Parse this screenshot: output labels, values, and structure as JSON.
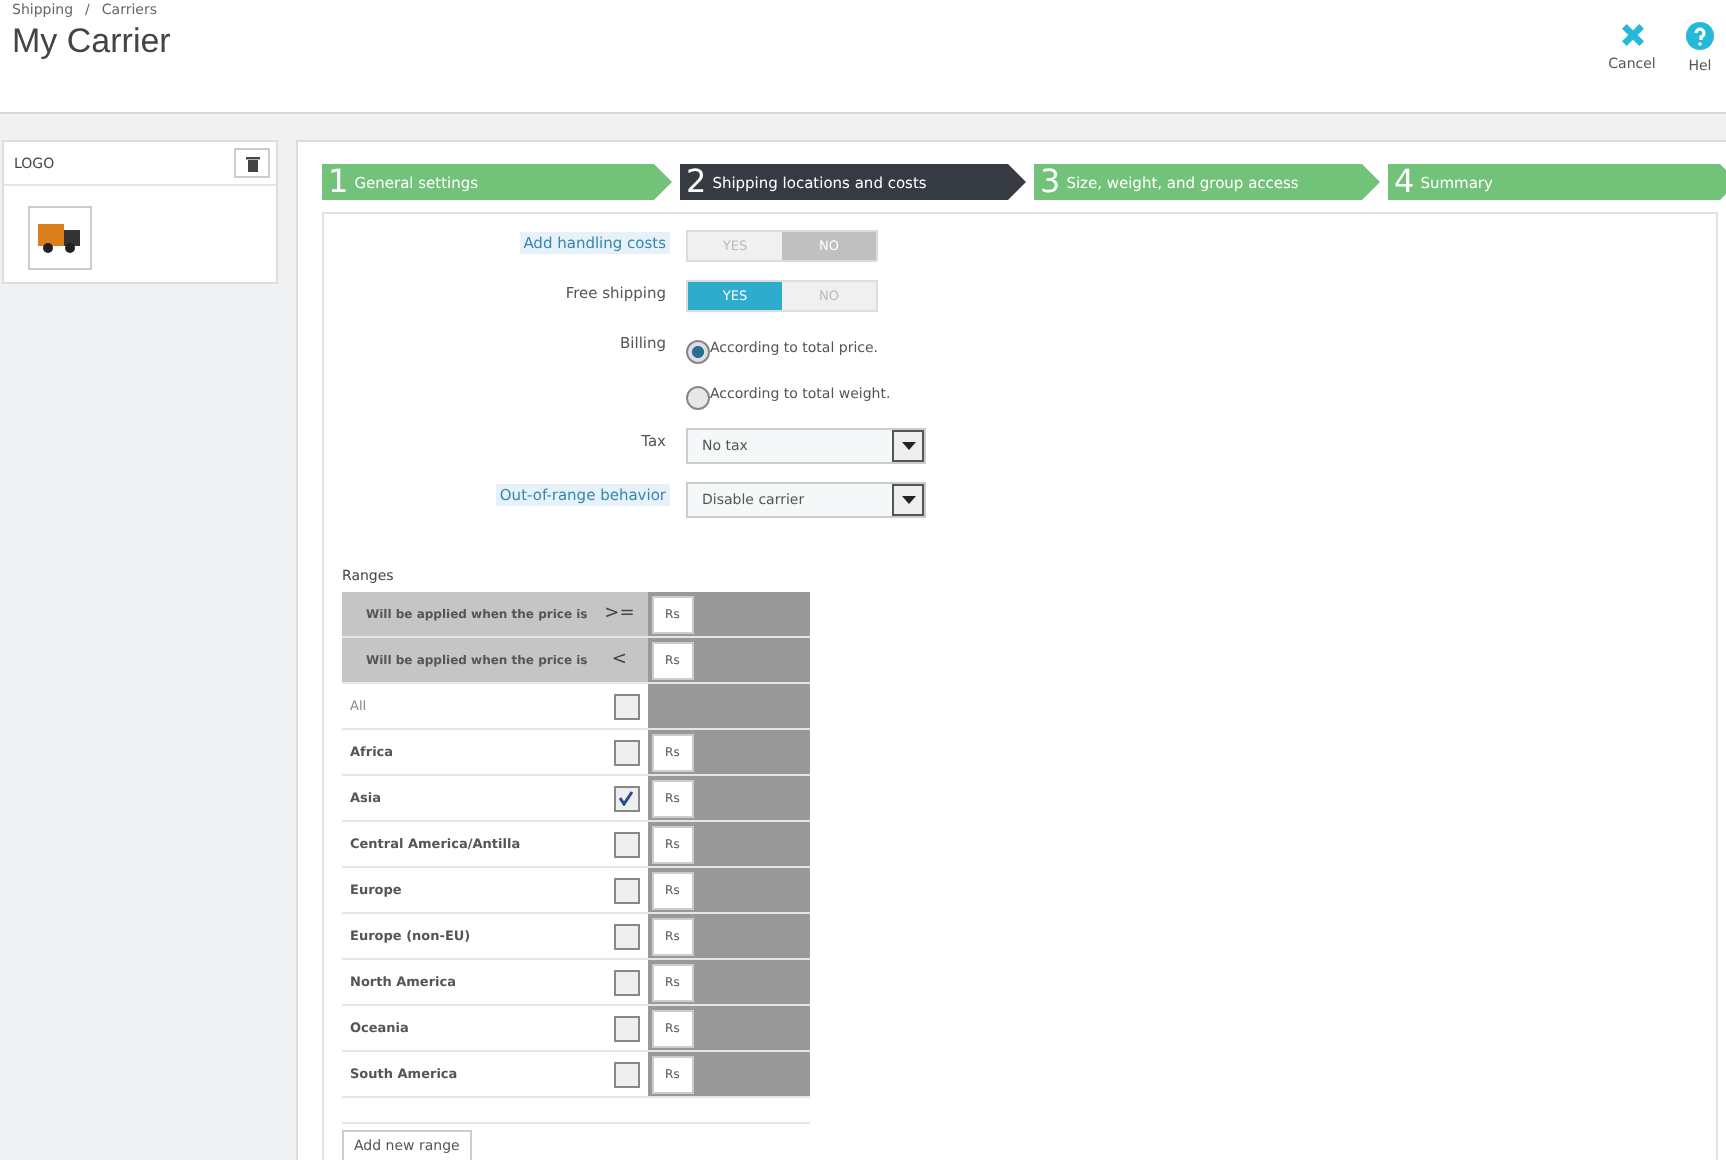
{
  "breadcrumb": {
    "items": [
      "Shipping",
      "Carriers"
    ],
    "separator": "/"
  },
  "title": "My Carrier",
  "toolbar": [
    {
      "kind": "cancel",
      "label": "Cancel"
    },
    {
      "kind": "help",
      "label": "Hel"
    }
  ],
  "logo_panel": {
    "title": "LOGO"
  },
  "steps": [
    {
      "number": "1",
      "label": "General settings",
      "selected": false
    },
    {
      "number": "2",
      "label": "Shipping locations and costs",
      "selected": true
    },
    {
      "number": "3",
      "label": "Size, weight, and group access",
      "selected": false
    },
    {
      "number": "4",
      "label": "Summary",
      "selected": false
    }
  ],
  "form": [
    {
      "kind": "switch",
      "label": "Add handling costs",
      "hint": true,
      "options": [
        {
          "label": "YES",
          "kind": "yes",
          "selected": false
        },
        {
          "label": "NO",
          "kind": "no",
          "selected": true
        }
      ]
    },
    {
      "kind": "switch",
      "label": "Free shipping",
      "hint": false,
      "options": [
        {
          "label": "YES",
          "kind": "yes",
          "selected": true
        },
        {
          "label": "NO",
          "kind": "no",
          "selected": false
        }
      ]
    },
    {
      "kind": "radio",
      "label": "Billing",
      "hint": false,
      "options": [
        {
          "label": "According to total price.",
          "selected": true
        },
        {
          "label": "According to total weight.",
          "selected": false
        }
      ]
    },
    {
      "kind": "select",
      "label": "Tax",
      "hint": false,
      "value": "No tax"
    },
    {
      "kind": "select",
      "label": "Out-of-range behavior",
      "hint": true,
      "value": "Disable carrier"
    }
  ],
  "ranges": {
    "title": "Ranges",
    "headers": [
      {
        "label": "Will be applied when the price is",
        "operator": ">=",
        "currency": "Rs"
      },
      {
        "label": "Will be applied when the price is",
        "operator": "<",
        "currency": "Rs"
      }
    ],
    "zones": [
      {
        "name": "All",
        "kind": "all",
        "checked": false
      },
      {
        "name": "Africa",
        "kind": "zone",
        "checked": false,
        "currency": "Rs"
      },
      {
        "name": "Asia",
        "kind": "zone",
        "checked": true,
        "currency": "Rs"
      },
      {
        "name": "Central America/Antilla",
        "kind": "zone",
        "checked": false,
        "currency": "Rs"
      },
      {
        "name": "Europe",
        "kind": "zone",
        "checked": false,
        "currency": "Rs"
      },
      {
        "name": "Europe (non-EU)",
        "kind": "zone",
        "checked": false,
        "currency": "Rs"
      },
      {
        "name": "North America",
        "kind": "zone",
        "checked": false,
        "currency": "Rs"
      },
      {
        "name": "Oceania",
        "kind": "zone",
        "checked": false,
        "currency": "Rs"
      },
      {
        "name": "South America",
        "kind": "zone",
        "checked": false,
        "currency": "Rs"
      }
    ],
    "add_button": "Add new range"
  }
}
